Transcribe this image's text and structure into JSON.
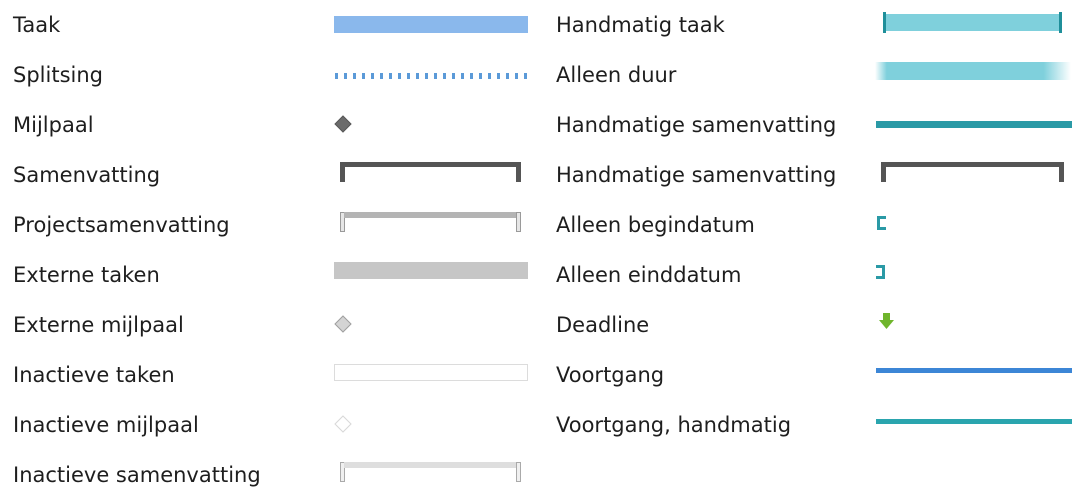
{
  "legend": {
    "left": [
      {
        "label": "Taak",
        "icon": "task-bar",
        "color": "#8ab8ec"
      },
      {
        "label": "Splitsing",
        "icon": "split-dotted-line",
        "color": "#5b9ad8"
      },
      {
        "label": "Mijlpaal",
        "icon": "milestone-diamond",
        "color": "#6b6b6b"
      },
      {
        "label": "Samenvatting",
        "icon": "summary-bracket-bar",
        "color": "#555555"
      },
      {
        "label": "Projectsamenvatting",
        "icon": "project-summary-bracket-bar",
        "color": "#b4b4b4"
      },
      {
        "label": "Externe taken",
        "icon": "external-task-bar",
        "color": "#c6c6c6"
      },
      {
        "label": "Externe mijlpaal",
        "icon": "external-milestone-diamond",
        "color": "#d4d4d4"
      },
      {
        "label": "Inactieve taken",
        "icon": "inactive-task-bar",
        "color": "#dcdcdc"
      },
      {
        "label": "Inactieve mijlpaal",
        "icon": "inactive-milestone-diamond",
        "color": "#e2e2e2"
      },
      {
        "label": "Inactieve samenvatting",
        "icon": "inactive-summary-bracket-bar",
        "color": "#dedede"
      }
    ],
    "right": [
      {
        "label": "Handmatig taak",
        "icon": "manual-task-bar",
        "color": "#7fd0dc"
      },
      {
        "label": "Alleen duur",
        "icon": "duration-only-bar",
        "color": "#7fd0dc"
      },
      {
        "label": "Handmatige samenvatting",
        "icon": "manual-summary-rollup-line",
        "color": "#2a9aa6"
      },
      {
        "label": "Handmatige samenvatting",
        "icon": "manual-summary-bracket-bar",
        "color": "#555555"
      },
      {
        "label": "Alleen begindatum",
        "icon": "start-only-bracket",
        "color": "#2a9aa6"
      },
      {
        "label": "Alleen einddatum",
        "icon": "finish-only-bracket",
        "color": "#2a9aa6"
      },
      {
        "label": "Deadline",
        "icon": "deadline-arrow",
        "color": "#6fb52c"
      },
      {
        "label": "Voortgang",
        "icon": "progress-line",
        "color": "#3c86d6"
      },
      {
        "label": "Voortgang, handmatig",
        "icon": "manual-progress-line",
        "color": "#2aa5ae"
      }
    ]
  }
}
